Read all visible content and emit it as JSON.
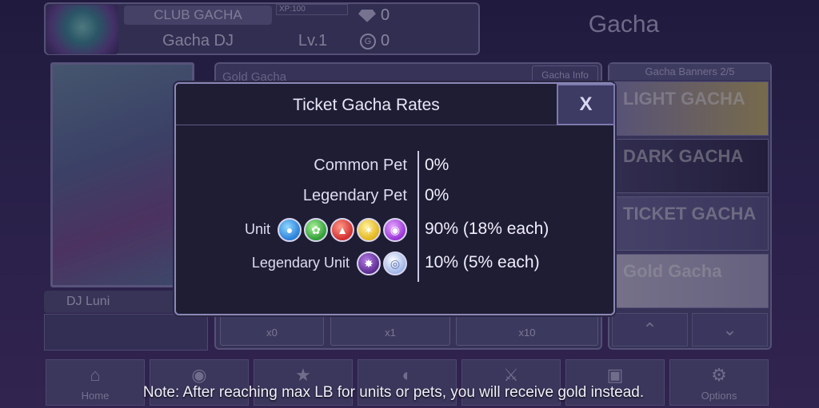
{
  "profile": {
    "club": "CLUB GACHA",
    "player_name": "Gacha DJ",
    "xp": "XP:100",
    "level": "Lv.1",
    "gems": "0",
    "gold": "0"
  },
  "screen_title": "Gacha",
  "character": {
    "name": "DJ Luni"
  },
  "gacha_panel": {
    "title": "Gold Gacha",
    "info_button": "Gacha Info",
    "pull_single": "x0",
    "pull_x1": "x1",
    "pull_x10": "x10"
  },
  "banners": {
    "header": "Gacha Banners 2/5",
    "items": [
      "LIGHT GACHA",
      "DARK GACHA",
      "TICKET GACHA",
      "Gold Gacha"
    ]
  },
  "nav": {
    "home": "Home",
    "options": "Options"
  },
  "modal": {
    "title": "Ticket Gacha Rates",
    "close": "X",
    "rows": [
      {
        "label": "Common Pet",
        "value": "0%"
      },
      {
        "label": "Legendary Pet",
        "value": "0%"
      },
      {
        "label": "Unit",
        "value": "90% (18% each)",
        "icons": [
          "water-orb",
          "wind-orb",
          "fire-orb",
          "light-orb",
          "dark-orb"
        ]
      },
      {
        "label": "Legendary Unit",
        "value": "10% (5% each)",
        "icons": [
          "legendary-dark-orb",
          "legendary-light-orb"
        ]
      }
    ]
  },
  "note": "Note: After reaching max LB for units or pets, you will receive gold instead.",
  "colors": {
    "modal_bg": "#1f1d33",
    "modal_border": "#8a88b5",
    "orb_blue": "#2a7fd9",
    "orb_green": "#2f9d35",
    "orb_red": "#d22d2d",
    "orb_yellow": "#e3b51b",
    "orb_purple": "#9a33d6"
  }
}
